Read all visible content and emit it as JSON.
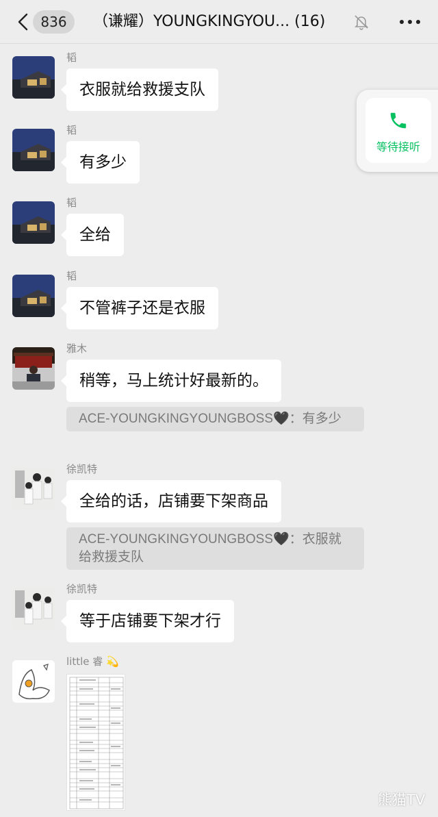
{
  "header": {
    "unread_count": "836",
    "title": "（谦耀）YOUNGKINGYOU... (16)"
  },
  "call_widget": {
    "label": "等待接听"
  },
  "messages": [
    {
      "sender": "韬",
      "text": "衣服就给救援支队"
    },
    {
      "sender": "韬",
      "text": "有多少"
    },
    {
      "sender": "韬",
      "text": "全给"
    },
    {
      "sender": "韬",
      "text": "不管裤子还是衣服"
    },
    {
      "sender": "雅木",
      "text": "稍等，马上统计好最新的。",
      "quote": {
        "author": "ACE-YOUNGKINGYOUNGBOSS",
        "emoji": "🖤",
        "sep": "：",
        "text": "有多少"
      }
    },
    {
      "sender": "徐凯特",
      "text": "全给的话，店铺要下架商品",
      "quote": {
        "author": "ACE-YOUNGKINGYOUNGBOSS",
        "emoji": "🖤",
        "sep": "：",
        "text": "衣服就给救援支队"
      }
    },
    {
      "sender": "徐凯特",
      "text": "等于店铺要下架才行"
    },
    {
      "sender": "little 睿",
      "sender_emoji": "💫",
      "image": "document"
    }
  ],
  "watermark": "熊猫TV"
}
